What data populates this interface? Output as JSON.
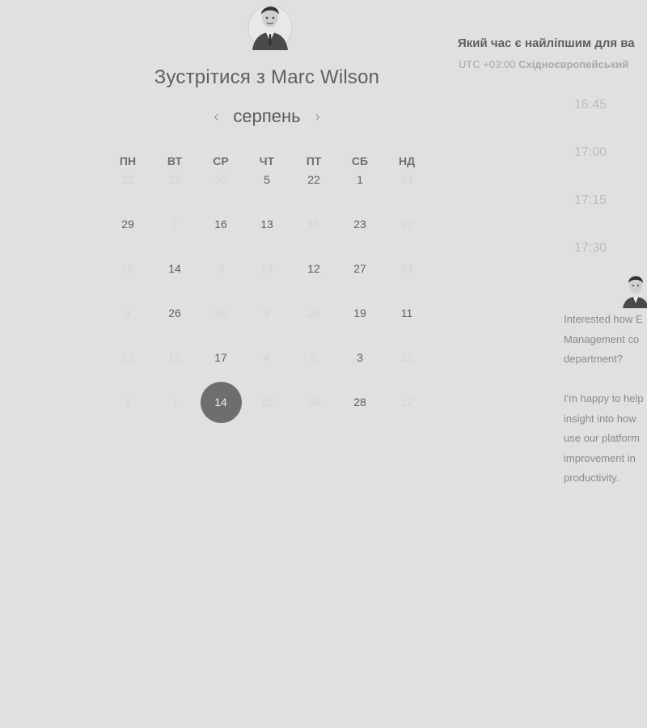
{
  "scheduler": {
    "title_prefix": "Зустрітися з",
    "host_name": "Marc Wilson",
    "month": "серпень",
    "prev_icon": "‹",
    "next_icon": "›",
    "weekdays": [
      "ПН",
      "ВТ",
      "СР",
      "ЧТ",
      "ПТ",
      "СБ",
      "НД"
    ],
    "weeks": [
      [
        {
          "d": "22",
          "m": true
        },
        {
          "d": "29",
          "m": true
        },
        {
          "d": "30",
          "m": true
        },
        {
          "d": "5",
          "m": false
        },
        {
          "d": "22",
          "m": false
        },
        {
          "d": "1",
          "m": false
        },
        {
          "d": "14",
          "m": true
        }
      ],
      [
        {
          "d": "29",
          "m": false
        },
        {
          "d": "7",
          "m": true
        },
        {
          "d": "16",
          "m": false
        },
        {
          "d": "13",
          "m": false
        },
        {
          "d": "16",
          "m": true
        },
        {
          "d": "23",
          "m": false
        },
        {
          "d": "27",
          "m": true
        }
      ],
      [
        {
          "d": "16",
          "m": true
        },
        {
          "d": "14",
          "m": false
        },
        {
          "d": "3",
          "m": true
        },
        {
          "d": "17",
          "m": true
        },
        {
          "d": "12",
          "m": false
        },
        {
          "d": "27",
          "m": false
        },
        {
          "d": "24",
          "m": true
        }
      ],
      [
        {
          "d": "3",
          "m": true
        },
        {
          "d": "26",
          "m": false
        },
        {
          "d": "26",
          "m": true
        },
        {
          "d": "9",
          "m": true
        },
        {
          "d": "24",
          "m": true
        },
        {
          "d": "19",
          "m": false
        },
        {
          "d": "11",
          "m": false
        }
      ],
      [
        {
          "d": "23",
          "m": true
        },
        {
          "d": "19",
          "m": true
        },
        {
          "d": "17",
          "m": false
        },
        {
          "d": "4",
          "m": true
        },
        {
          "d": "6",
          "m": true
        },
        {
          "d": "3",
          "m": false
        },
        {
          "d": "31",
          "m": true
        }
      ],
      [
        {
          "d": "1",
          "m": true
        },
        {
          "d": "1",
          "m": true
        },
        {
          "d": "14",
          "m": false,
          "s": true
        },
        {
          "d": "15",
          "m": true
        },
        {
          "d": "30",
          "m": true
        },
        {
          "d": "28",
          "m": false
        },
        {
          "d": "12",
          "m": true
        }
      ]
    ]
  },
  "times": {
    "question": "Який час є найліпшим для ва",
    "tz_offset": "UTC +03:00",
    "tz_name": "Східноєвропейський",
    "slots": [
      "16:45",
      "17:00",
      "17:15",
      "17:30"
    ]
  },
  "chat": {
    "lines": [
      "Interested how E",
      "Management co",
      "department?",
      "",
      "I'm happy to help",
      "insight into how",
      "use our platform",
      "improvement in",
      "productivity."
    ]
  },
  "colors": {
    "background": "#e0e0e0",
    "selected_day": "#6e6e6e",
    "muted_day": "#d4d4d4"
  }
}
